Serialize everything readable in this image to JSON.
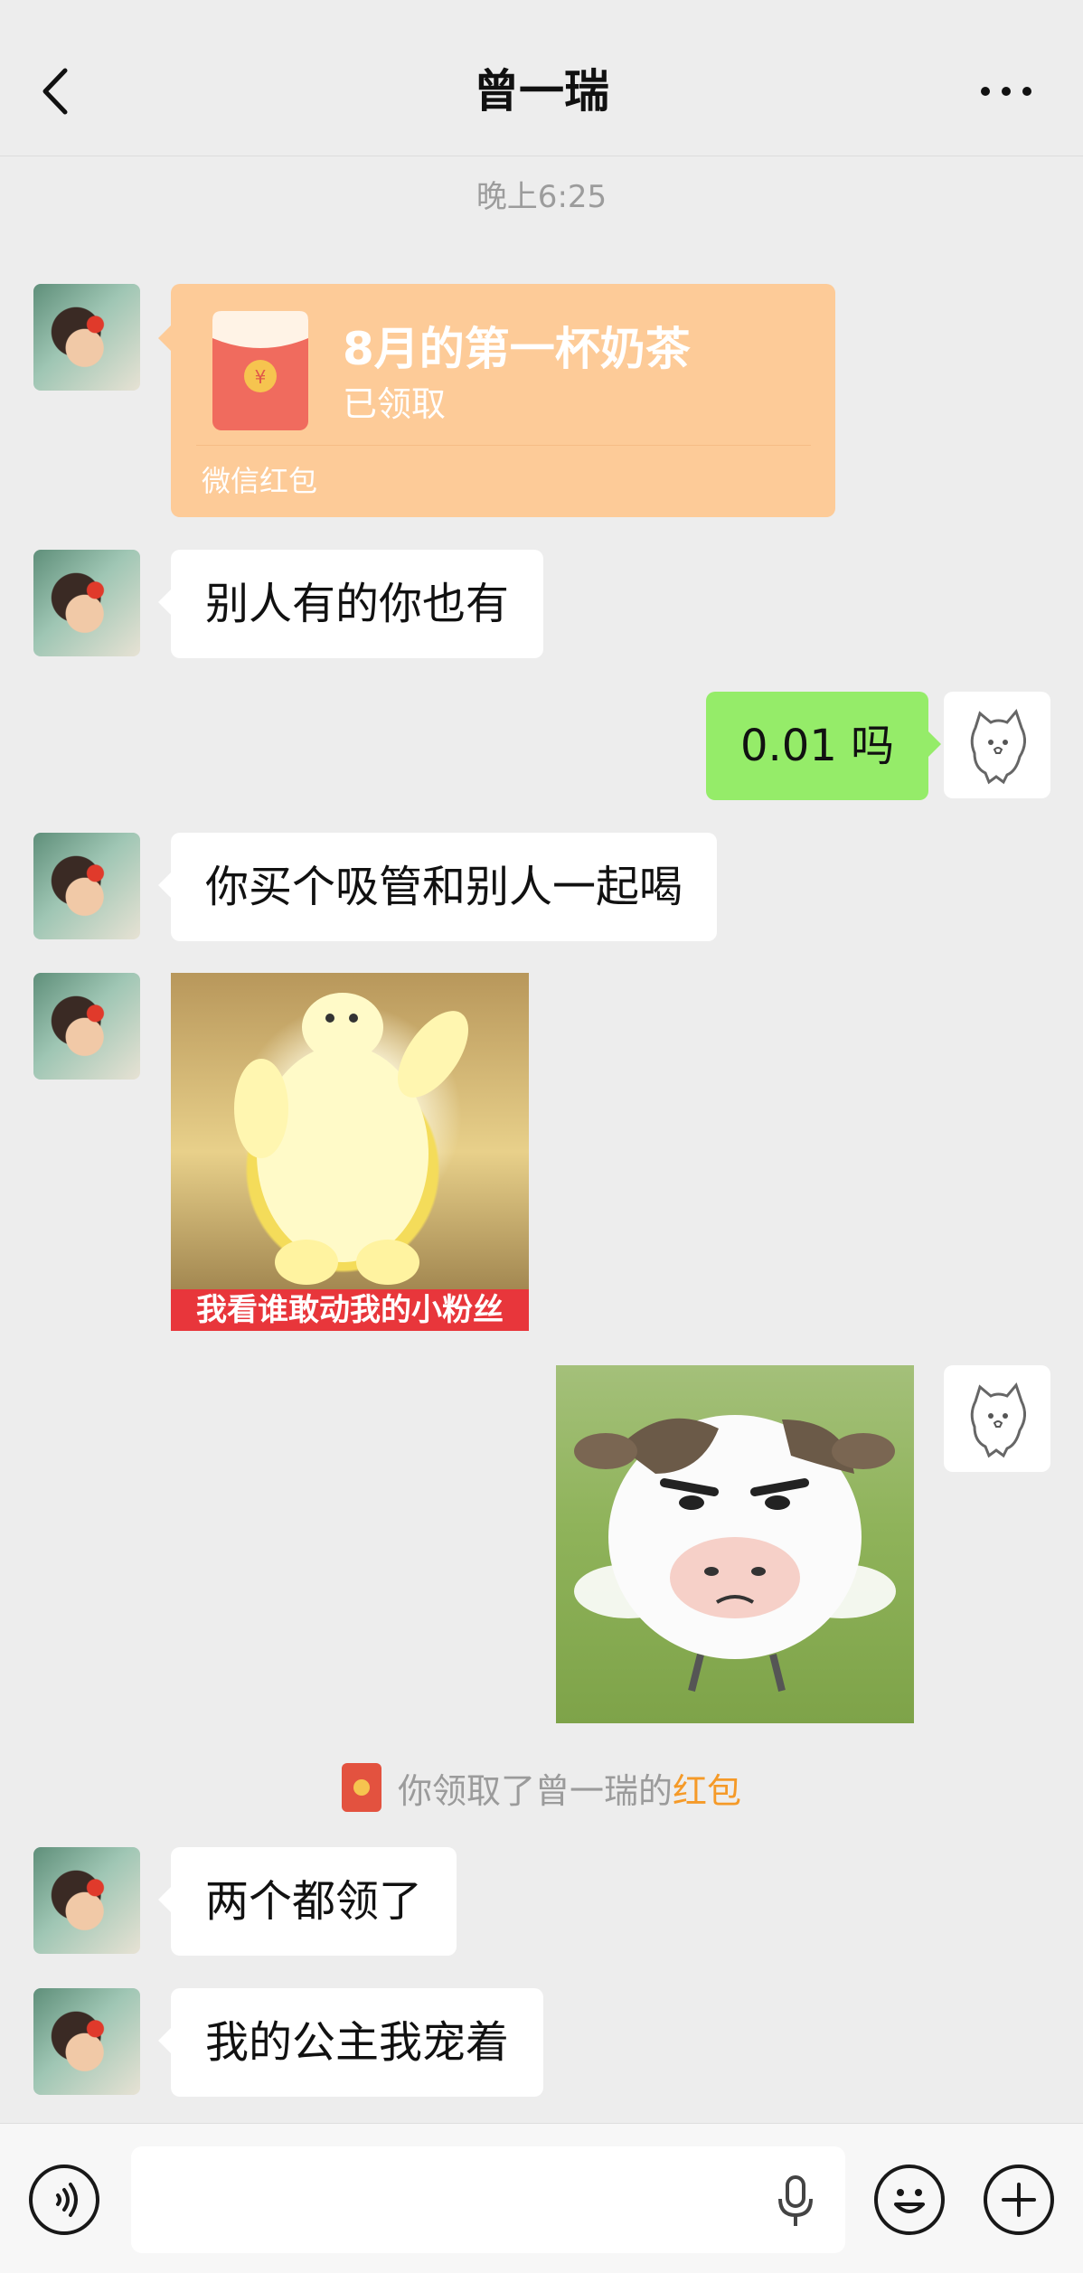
{
  "header": {
    "title": "曾一瑞"
  },
  "chat": {
    "timestamp": "晚上6:25",
    "red_packet": {
      "title": "8月的第一杯奶茶",
      "status": "已领取",
      "label": "微信红包"
    },
    "messages": [
      {
        "side": "left",
        "text": "别人有的你也有"
      },
      {
        "side": "right",
        "text": "0.01 吗"
      },
      {
        "side": "left",
        "text": "你买个吸管和别人一起喝"
      },
      {
        "side": "left",
        "text": "两个都领了"
      },
      {
        "side": "left",
        "text": "我的公主我宠着"
      }
    ],
    "sticker_caption": "我看谁敢动我的小粉丝",
    "system": {
      "prefix": "你领取了曾一瑞的",
      "link": "红包"
    }
  },
  "icons": {
    "back": "chevron-left-icon",
    "more": "more-dots-icon",
    "voice": "voice-icon",
    "mic": "microphone-icon",
    "emoji": "emoji-icon",
    "add": "plus-icon"
  },
  "colors": {
    "background": "#ededed",
    "my_bubble": "#95ec69",
    "red_packet": "#fdcb98",
    "link": "#f59a28"
  }
}
